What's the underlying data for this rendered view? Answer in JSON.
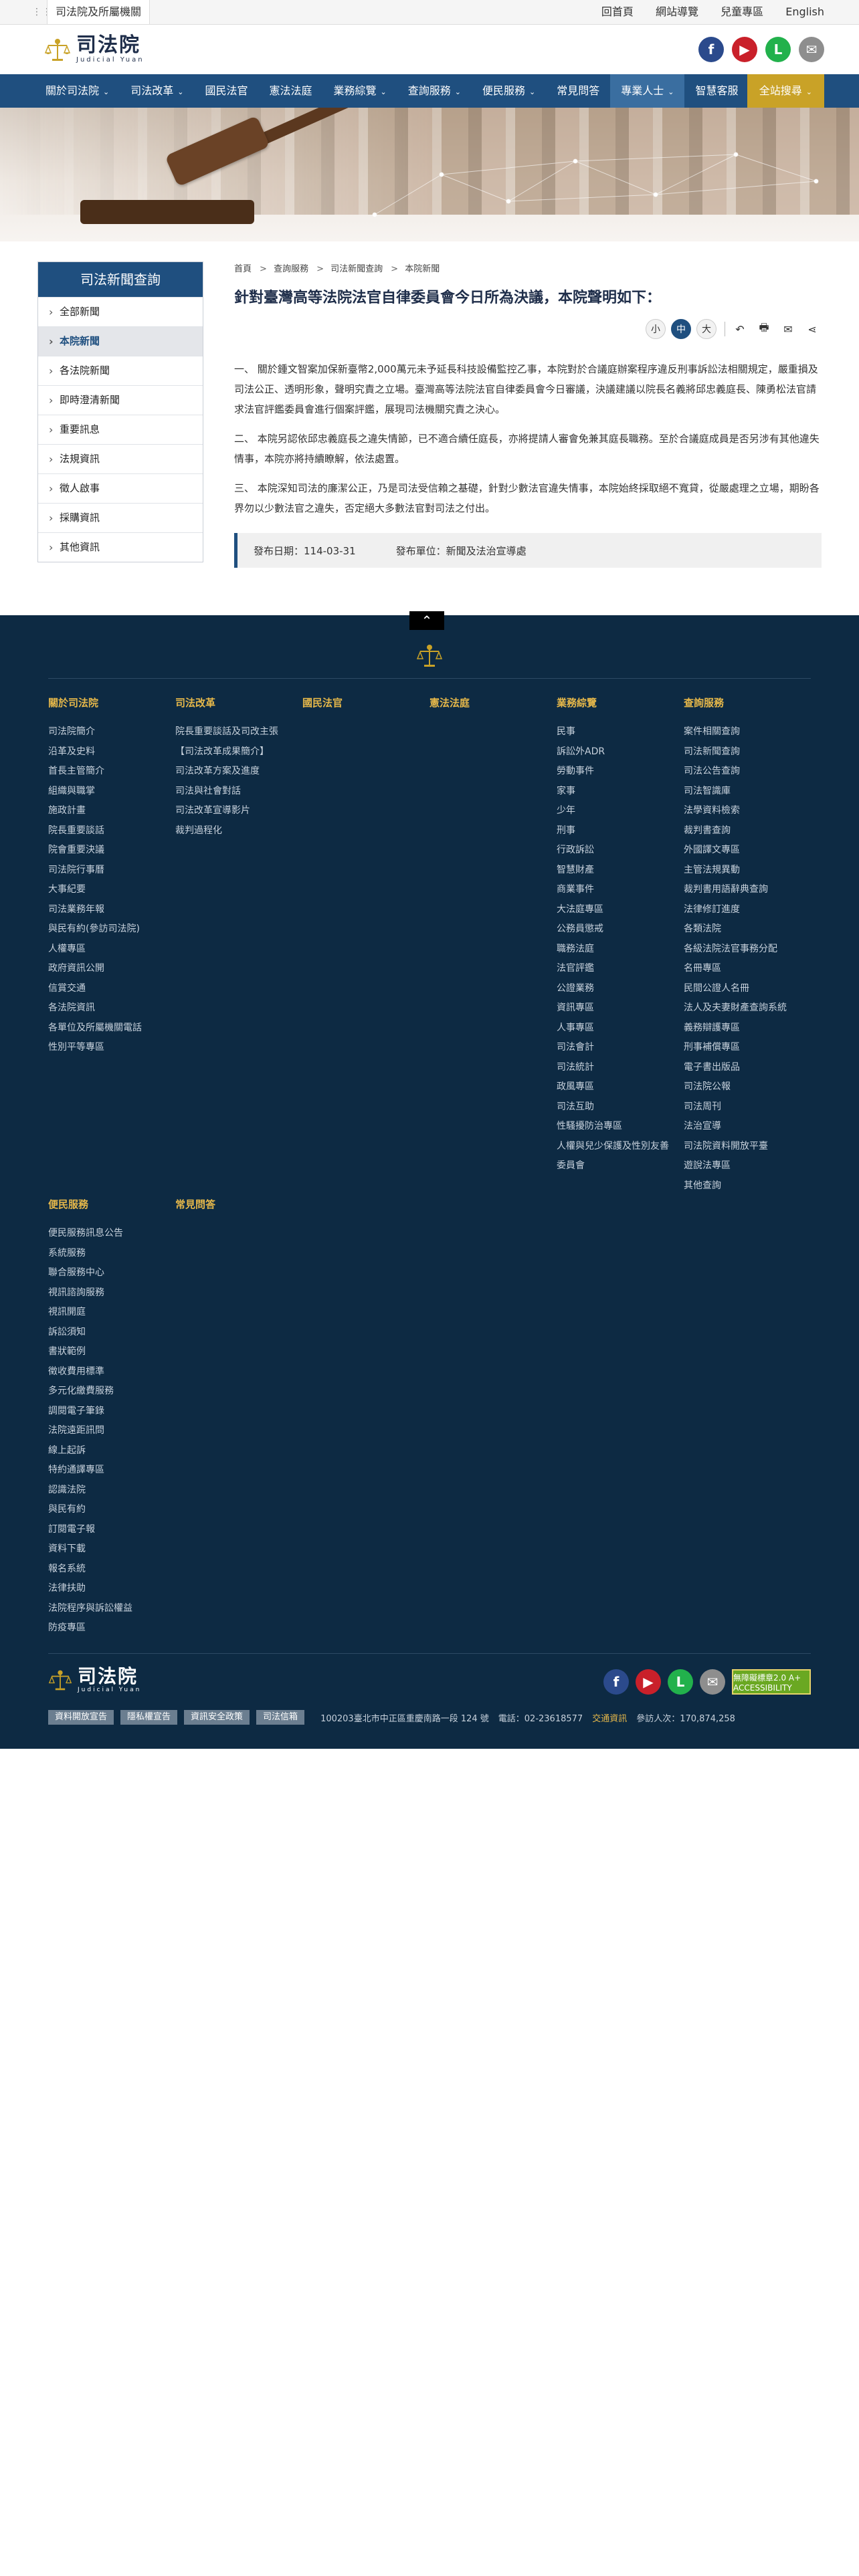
{
  "topbar": {
    "org_link": "司法院及所屬機關",
    "links": [
      "回首頁",
      "網站導覽",
      "兒童專區",
      "English"
    ]
  },
  "header": {
    "logo_zh": "司法院",
    "logo_en": "Judicial Yuan",
    "social": {
      "facebook": "f",
      "youtube": "▶",
      "line": "L",
      "mail": "✉"
    }
  },
  "nav": {
    "items": [
      {
        "label": "關於司法院",
        "has_caret": true
      },
      {
        "label": "司法改革",
        "has_caret": true
      },
      {
        "label": "國民法官",
        "has_caret": false
      },
      {
        "label": "憲法法庭",
        "has_caret": false
      },
      {
        "label": "業務綜覽",
        "has_caret": true
      },
      {
        "label": "查詢服務",
        "has_caret": true
      },
      {
        "label": "便民服務",
        "has_caret": true
      },
      {
        "label": "常見問答",
        "has_caret": false
      },
      {
        "label": "專業人士",
        "has_caret": true
      },
      {
        "label": "智慧客服",
        "has_caret": false
      }
    ],
    "active_index": 8,
    "search_label": "全站搜尋"
  },
  "sidebar": {
    "title": "司法新聞查詢",
    "items": [
      "全部新聞",
      "本院新聞",
      "各法院新聞",
      "即時澄清新聞",
      "重要訊息",
      "法規資訊",
      "徵人啟事",
      "採購資訊",
      "其他資訊"
    ],
    "active_index": 1
  },
  "breadcrumb": [
    "首頁",
    "查詢服務",
    "司法新聞查詢",
    "本院新聞"
  ],
  "breadcrumb_sep": ">",
  "article": {
    "title": "針對臺灣高等法院法官自律委員會今日所為決議，本院聲明如下：",
    "font_sizes": {
      "small": "小",
      "medium": "中",
      "large": "大"
    },
    "paragraphs": [
      "一、 關於鍾文智案加保新臺幣2,000萬元未予延長科技設備監控乙事，本院對於合議庭辦案程序違反刑事訴訟法相關規定，嚴重損及司法公正、透明形象，聲明究責之立場。臺灣高等法院法官自律委員會今日審議，決議建議以院長名義將邱忠義庭長、陳勇松法官請求法官評鑑委員會進行個案評鑑，展現司法機關究責之決心。",
      "二、 本院另認依邱忠義庭長之違失情節，已不適合續任庭長，亦將提請人審會免兼其庭長職務。至於合議庭成員是否另涉有其他違失情事，本院亦將持續瞭解，依法處置。",
      "三、 本院深知司法的廉潔公正，乃是司法受信賴之基礎，針對少數法官違失情事，本院始終採取絕不寬貸，從嚴處理之立場，期盼各界勿以少數法官之違失，否定絕大多數法官對司法之付出。"
    ],
    "publish_date": "發布日期：114-03-31",
    "publish_unit": "發布單位：新聞及法治宣導處"
  },
  "footer": {
    "to_top_icon": "chevron-up",
    "columns": [
      {
        "head": "關於司法院",
        "links": [
          "司法院簡介",
          "沿革及史料",
          "首長主管簡介",
          "組織與職掌",
          "施政計畫",
          "院長重要談話",
          "院會重要決議",
          "司法院行事曆",
          "大事紀要",
          "司法業務年報",
          "與民有約(參訪司法院)",
          "人權專區",
          "政府資訊公開",
          "信賞交通",
          "各法院資訊",
          "各單位及所屬機關電話",
          "性別平等專區"
        ]
      },
      {
        "head": "司法改革",
        "links": [
          "院長重要談話及司改主張",
          "【司法改革成果簡介】",
          "司法改革方案及進度",
          "司法與社會對話",
          "司法改革宣導影片",
          "裁判過程化"
        ]
      },
      {
        "head": "國民法官",
        "links": []
      },
      {
        "head": "憲法法庭",
        "links": []
      },
      {
        "head": "業務綜覽",
        "links": [
          "民事",
          "訴訟外ADR",
          "勞動事件",
          "家事",
          "少年",
          "刑事",
          "行政訴訟",
          "智慧財產",
          "商業事件",
          "大法庭專區",
          "公務員懲戒",
          "職務法庭",
          "法官評鑑",
          "公證業務",
          "資訊專區",
          "人事專區",
          "司法會計",
          "司法統計",
          "政風專區",
          "司法互助",
          "性騷擾防治專區",
          "人權與兒少保護及性別友善委員會"
        ]
      },
      {
        "head": "查詢服務",
        "links": [
          "案件相關查詢",
          "司法新聞查詢",
          "司法公告查詢",
          "司法智識庫",
          "法學資料檢索",
          "裁判書查詢",
          "外國譯文專區",
          "主管法規異動",
          "裁判書用語辭典查詢",
          "法律修訂進度",
          "各類法院",
          "各級法院法官事務分配",
          "名冊專區",
          "民間公證人名冊",
          "法人及夫妻財產查詢系統",
          "義務辯護專區",
          "刑事補償專區",
          "電子書出版品",
          "司法院公報",
          "司法周刊",
          "法治宣導",
          "司法院資料開放平臺",
          "遊說法專區",
          "其他查詢"
        ]
      },
      {
        "head": "便民服務",
        "links": [
          "便民服務訊息公告",
          "系統服務",
          "聯合服務中心",
          "視訊諮詢服務",
          "視訊開庭",
          "訴訟須知",
          "書狀範例",
          "徵收費用標準",
          "多元化繳費服務",
          "調閱電子筆錄",
          "法院遠距訊問",
          "線上起訴",
          "特約通譯專區",
          "認識法院",
          "與民有約",
          "訂閱電子報",
          "資料下載",
          "報名系統",
          "法律扶助",
          "法院程序與訴訟權益",
          "防疫專區"
        ]
      },
      {
        "head": "常見問答",
        "links": []
      }
    ],
    "logo_zh": "司法院",
    "logo_en": "Judicial Yuan",
    "a11y_badge": "無障礙標章2.0 A+ ACCESSIBILITY",
    "buttons": [
      "資料開放宣告",
      "隱私權宣告",
      "資訊安全政策",
      "司法信箱"
    ],
    "address": "100203臺北市中正區重慶南路一段 124 號",
    "phone": "電話：02-23618577",
    "traffic": "交通資訊",
    "visitors": "參訪人次：170,874,258"
  },
  "colors": {
    "nav_bg": "#1f4f7f",
    "footer_bg": "#0d2a43",
    "footer_heading": "#e6b84a",
    "search_button": "#c9a227"
  }
}
